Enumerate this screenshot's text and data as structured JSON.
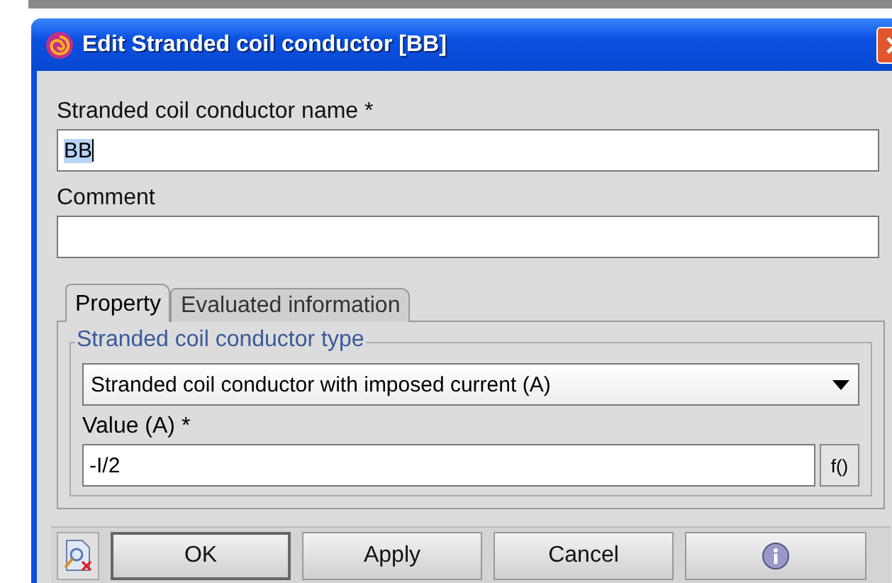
{
  "window": {
    "title": "Edit Stranded coil conductor [BB]"
  },
  "name_field": {
    "label": "Stranded coil conductor name *",
    "value": "BB",
    "value_selected": true
  },
  "comment_field": {
    "label": "Comment"
  },
  "tabs": [
    {
      "label": "Property",
      "selected": true
    },
    {
      "label": "Evaluated information",
      "selected": false
    }
  ],
  "type_group": {
    "title": "Stranded coil conductor  type",
    "dropdown": "Stranded coil conductor with imposed current (A)"
  },
  "value_field": {
    "label": "Value (A) *",
    "value": "-I/2",
    "function_button": "f()"
  },
  "buttons": [
    {
      "kind": "text",
      "label": "OK",
      "default": true
    },
    {
      "kind": "text",
      "label": "Apply",
      "default": false
    },
    {
      "kind": "text",
      "label": "Cancel",
      "default": false
    },
    {
      "kind": "info"
    }
  ]
}
